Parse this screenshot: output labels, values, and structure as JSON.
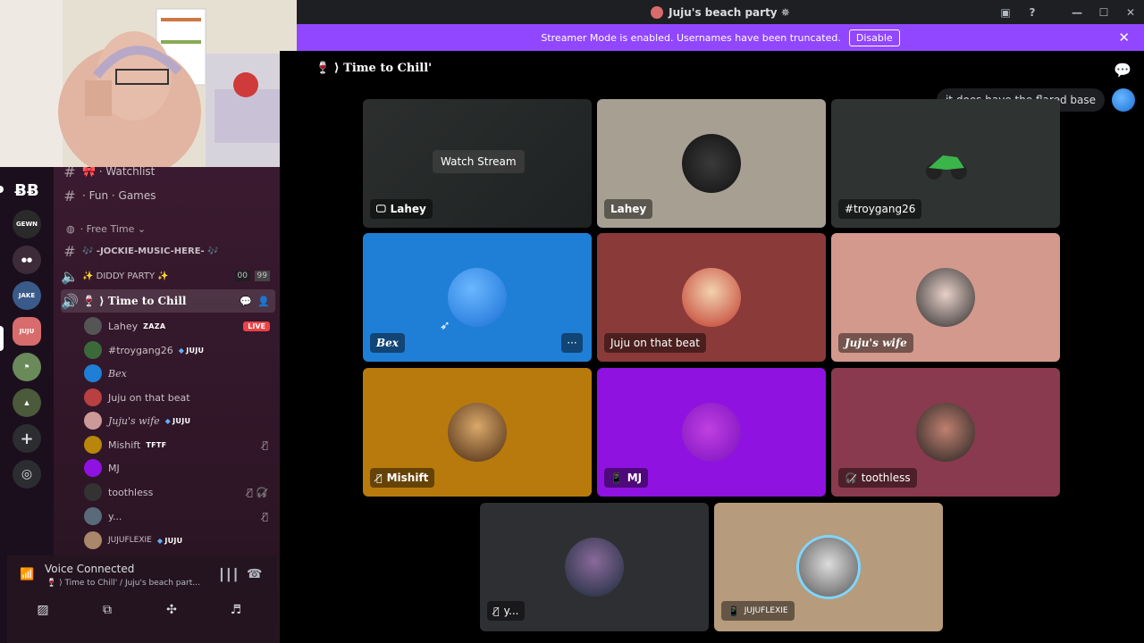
{
  "window": {
    "title": "Juju's beach party ✵"
  },
  "streamer": {
    "message": "Streamer Mode is enabled. Usernames have been truncated.",
    "disable_label": "Disable"
  },
  "sidebar": {
    "channels": [
      {
        "label": "🎀 · Watchlist"
      },
      {
        "label": "· Fun · Games"
      },
      {
        "label": "🎶 -JOCKIE-MUSIC-HERE- 🎶"
      },
      {
        "label": "✨ DIDDY PARTY ✨",
        "counter_a": "00",
        "counter_b": "99"
      },
      {
        "label": "🍷 ⟩ Time to Chill"
      }
    ],
    "category": "Free Time",
    "voice_users": [
      {
        "name": "Lahey",
        "tag": "ZAZA",
        "live": "LIVE"
      },
      {
        "name": "#troygang26",
        "tag": "JUJU"
      },
      {
        "name": "Bex"
      },
      {
        "name": "Juju on that beat"
      },
      {
        "name": "Juju's wife",
        "tag": "JUJU"
      },
      {
        "name": "Mishift",
        "tag": "TFTF"
      },
      {
        "name": "MJ"
      },
      {
        "name": "toothless"
      },
      {
        "name": "y..."
      },
      {
        "name": "JUJUFLEXIE",
        "tag": "JUJU"
      }
    ]
  },
  "voice_panel": {
    "status": "Voice Connected",
    "sub": "🍷 ⟩ Time to Chill' / Juju's beach part..."
  },
  "main": {
    "channel_crumb": "🍷 ⟩ Time to Chill'",
    "chat_bubble": "it does have the flared base",
    "watch_stream": "Watch Stream",
    "tiles": [
      {
        "name": "Lahey"
      },
      {
        "name": "Lahey"
      },
      {
        "name": "#troygang26"
      },
      {
        "name": "Bex"
      },
      {
        "name": "Juju on that beat"
      },
      {
        "name": "Juju's wife"
      },
      {
        "name": "Mishift"
      },
      {
        "name": "MJ"
      },
      {
        "name": "toothless"
      },
      {
        "name": "y..."
      },
      {
        "name": "JUJUFLEXIE"
      }
    ]
  },
  "colors": {
    "accent": "#9147ff",
    "live": "#ed4245",
    "bex_tile": "#1f7fd6",
    "mj_tile": "#8f12e0"
  }
}
